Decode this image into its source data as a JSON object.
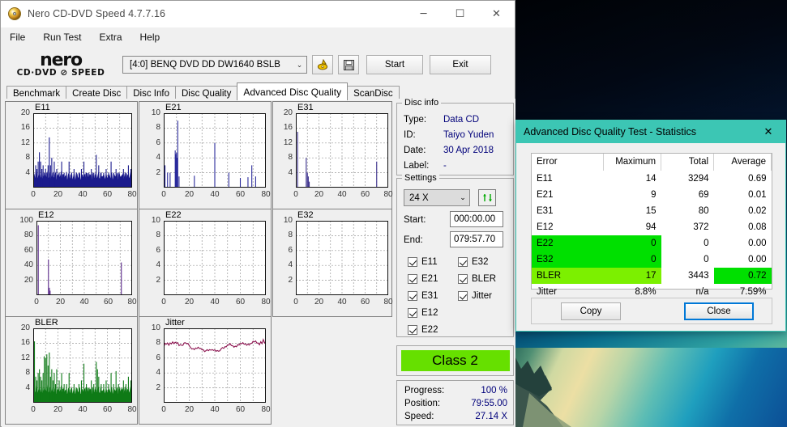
{
  "window": {
    "title": "Nero CD-DVD Speed 4.7.7.16",
    "icon": "nero-disc-icon",
    "minimize": "─",
    "maximize": "☐",
    "close": "✕"
  },
  "menu": {
    "items": [
      "File",
      "Run Test",
      "Extra",
      "Help"
    ]
  },
  "toolbar": {
    "logo_line1": "nero",
    "logo_line2": "CD·DVD ⊘ SPEED",
    "drive": "[4:0]   BENQ DVD DD DW1640 BSLB",
    "drive_arrow": "⌄",
    "eject_icon": "eject-disc-icon",
    "save_icon": "floppy-save-icon",
    "start_label": "Start",
    "exit_label": "Exit"
  },
  "tabs": {
    "items": [
      "Benchmark",
      "Create Disc",
      "Disc Info",
      "Disc Quality",
      "Advanced Disc Quality",
      "ScanDisc"
    ],
    "active": "Advanced Disc Quality"
  },
  "disc_info": {
    "legend": "Disc info",
    "rows": [
      {
        "key": "Type:",
        "value": "Data CD"
      },
      {
        "key": "ID:",
        "value": "Taiyo Yuden"
      },
      {
        "key": "Date:",
        "value": "30 Apr 2018"
      },
      {
        "key": "Label:",
        "value": "-"
      }
    ]
  },
  "settings": {
    "legend": "Settings",
    "speed": "24 X",
    "speed_arrow": "⌄",
    "refresh_icon": "refresh-speed-icon",
    "start_label": "Start:",
    "start_value": "000:00.00",
    "end_label": "End:",
    "end_value": "079:57.70",
    "checkboxes_left": [
      "E11",
      "E21",
      "E31",
      "E12",
      "E22"
    ],
    "checkboxes_right": [
      "E32",
      "BLER",
      "Jitter"
    ]
  },
  "class": {
    "label": "Class 2",
    "color": "#66e000"
  },
  "progress": {
    "rows": [
      {
        "key": "Progress:",
        "value": "100 %"
      },
      {
        "key": "Position:",
        "value": "79:55.00"
      },
      {
        "key": "Speed:",
        "value": "27.14 X"
      }
    ]
  },
  "stats_dialog": {
    "title": "Advanced Disc Quality Test - Statistics",
    "close_icon": "✕",
    "columns": [
      "Error",
      "Maximum",
      "Total",
      "Average"
    ],
    "rows": [
      {
        "error": "E11",
        "maximum": "14",
        "total": "3294",
        "average": "0.69",
        "hl": "none"
      },
      {
        "error": "E21",
        "maximum": "9",
        "total": "69",
        "average": "0.01",
        "hl": "none"
      },
      {
        "error": "E31",
        "maximum": "15",
        "total": "80",
        "average": "0.02",
        "hl": "none"
      },
      {
        "error": "E12",
        "maximum": "94",
        "total": "372",
        "average": "0.08",
        "hl": "none"
      },
      {
        "error": "E22",
        "maximum": "0",
        "total": "0",
        "average": "0.00",
        "hl": "green"
      },
      {
        "error": "E32",
        "maximum": "0",
        "total": "0",
        "average": "0.00",
        "hl": "green"
      },
      {
        "error": "BLER",
        "maximum": "17",
        "total": "3443",
        "average": "0.72",
        "hl": "bler"
      },
      {
        "error": "Jitter",
        "maximum": "8.8%",
        "total": "n/a",
        "average": "7.59%",
        "hl": "none"
      }
    ],
    "copy_label": "Copy",
    "close_label": "Close",
    "highlight_green": "#00e000",
    "highlight_bler": "#7cf000"
  },
  "chart_data": [
    {
      "type": "bar",
      "title": "E11",
      "color": "#1a1a8c",
      "xlabel": "",
      "ylabel": "",
      "xlim": [
        0,
        80
      ],
      "ylim": [
        0,
        20
      ],
      "xticks": [
        0,
        20,
        40,
        60,
        80
      ],
      "yticks": [
        4,
        8,
        12,
        16,
        20
      ],
      "grid": true,
      "baseline": 2.2,
      "peaks": [
        [
          1,
          3
        ],
        [
          2,
          6
        ],
        [
          3,
          5
        ],
        [
          4,
          7
        ],
        [
          5,
          9.5
        ],
        [
          6,
          7
        ],
        [
          7,
          5
        ],
        [
          8,
          6
        ],
        [
          9,
          4
        ],
        [
          10,
          5
        ],
        [
          11,
          4
        ],
        [
          12,
          6
        ],
        [
          13,
          13.5
        ],
        [
          14,
          6
        ],
        [
          15,
          8
        ],
        [
          16,
          4
        ],
        [
          17,
          7
        ],
        [
          18,
          4
        ],
        [
          19,
          5
        ],
        [
          21,
          4
        ],
        [
          23,
          7
        ],
        [
          25,
          4
        ],
        [
          27,
          4
        ],
        [
          29,
          7
        ],
        [
          31,
          4
        ],
        [
          33,
          5
        ],
        [
          35,
          4
        ],
        [
          37,
          4
        ],
        [
          39,
          5
        ],
        [
          41,
          7
        ],
        [
          43,
          4
        ],
        [
          45,
          4
        ],
        [
          47,
          5
        ],
        [
          49,
          4
        ],
        [
          51,
          8.8
        ],
        [
          53,
          6
        ],
        [
          55,
          4
        ],
        [
          57,
          4
        ],
        [
          59,
          5
        ],
        [
          61,
          4
        ],
        [
          63,
          7
        ],
        [
          65,
          4
        ],
        [
          67,
          5
        ],
        [
          69,
          4
        ],
        [
          71,
          3
        ],
        [
          73,
          5
        ],
        [
          75,
          4
        ],
        [
          77,
          6
        ],
        [
          79,
          5
        ]
      ]
    },
    {
      "type": "bar",
      "title": "E21",
      "color": "#2b2b9c",
      "xlabel": "",
      "ylabel": "",
      "xlim": [
        0,
        80
      ],
      "ylim": [
        0,
        10
      ],
      "xticks": [
        0,
        20,
        40,
        60,
        80
      ],
      "yticks": [
        2,
        4,
        6,
        8,
        10
      ],
      "grid": true,
      "baseline": 0,
      "peaks": [
        [
          1,
          3
        ],
        [
          3,
          2
        ],
        [
          5,
          2
        ],
        [
          9,
          5
        ],
        [
          9.5,
          4.5
        ],
        [
          10,
          4.7
        ],
        [
          10.5,
          4
        ],
        [
          11,
          9
        ],
        [
          12,
          1.5
        ],
        [
          24,
          1.6
        ],
        [
          40,
          6
        ],
        [
          51,
          2
        ],
        [
          60,
          1.3
        ],
        [
          66,
          1.4
        ],
        [
          69,
          3
        ],
        [
          72,
          1.5
        ]
      ]
    },
    {
      "type": "bar",
      "title": "E31",
      "color": "#3a2f8c",
      "xlabel": "",
      "ylabel": "",
      "xlim": [
        0,
        80
      ],
      "ylim": [
        0,
        20
      ],
      "xticks": [
        0,
        20,
        40,
        60,
        80
      ],
      "yticks": [
        4,
        8,
        12,
        16,
        20
      ],
      "grid": true,
      "baseline": 0,
      "peaks": [
        [
          1.5,
          15
        ],
        [
          9,
          8
        ],
        [
          10,
          4
        ],
        [
          10.8,
          3
        ],
        [
          11.6,
          1.6
        ],
        [
          70,
          7
        ]
      ]
    },
    {
      "type": "bar",
      "title": "E12",
      "color": "#5b2a8c",
      "xlabel": "",
      "ylabel": "",
      "xlim": [
        0,
        80
      ],
      "ylim": [
        0,
        100
      ],
      "xticks": [
        0,
        20,
        40,
        60,
        80
      ],
      "yticks": [
        20,
        40,
        60,
        80,
        100
      ],
      "grid": true,
      "baseline": 0,
      "peaks": [
        [
          1.5,
          94
        ],
        [
          10,
          48
        ],
        [
          10.8,
          10
        ],
        [
          11.4,
          6
        ],
        [
          71,
          44
        ]
      ]
    },
    {
      "type": "bar",
      "title": "E22",
      "color": "#5b2a8c",
      "xlabel": "",
      "ylabel": "",
      "xlim": [
        0,
        80
      ],
      "ylim": [
        0,
        10
      ],
      "xticks": [
        0,
        20,
        40,
        60,
        80
      ],
      "yticks": [
        2,
        4,
        6,
        8,
        10
      ],
      "grid": true,
      "baseline": 0,
      "peaks": []
    },
    {
      "type": "bar",
      "title": "E32",
      "color": "#5b2a8c",
      "xlabel": "",
      "ylabel": "",
      "xlim": [
        0,
        80
      ],
      "ylim": [
        0,
        10
      ],
      "xticks": [
        0,
        20,
        40,
        60,
        80
      ],
      "yticks": [
        2,
        4,
        6,
        8,
        10
      ],
      "grid": true,
      "baseline": 0,
      "peaks": []
    },
    {
      "type": "bar",
      "title": "BLER",
      "color": "#0e7a16",
      "xlabel": "",
      "ylabel": "",
      "xlim": [
        0,
        80
      ],
      "ylim": [
        0,
        20
      ],
      "xticks": [
        0,
        20,
        40,
        60,
        80
      ],
      "yticks": [
        4,
        8,
        12,
        16,
        20
      ],
      "grid": true,
      "baseline": 2.4,
      "peaks": [
        [
          1,
          16.5
        ],
        [
          2,
          7
        ],
        [
          3,
          6
        ],
        [
          4,
          8
        ],
        [
          5,
          9
        ],
        [
          6,
          7
        ],
        [
          7,
          6
        ],
        [
          8,
          8
        ],
        [
          9,
          12.5
        ],
        [
          10,
          12
        ],
        [
          11,
          13
        ],
        [
          12,
          10
        ],
        [
          13,
          13.5
        ],
        [
          14,
          7
        ],
        [
          15,
          9
        ],
        [
          16,
          6
        ],
        [
          17,
          8
        ],
        [
          18,
          5
        ],
        [
          19,
          9
        ],
        [
          21,
          6
        ],
        [
          23,
          8
        ],
        [
          25,
          5
        ],
        [
          27,
          5
        ],
        [
          29,
          8
        ],
        [
          31,
          4
        ],
        [
          33,
          5
        ],
        [
          35,
          4
        ],
        [
          37,
          5
        ],
        [
          39,
          6
        ],
        [
          41,
          10.5
        ],
        [
          43,
          5
        ],
        [
          45,
          4
        ],
        [
          47,
          6
        ],
        [
          49,
          5
        ],
        [
          51,
          11
        ],
        [
          52,
          9
        ],
        [
          53,
          7
        ],
        [
          55,
          5
        ],
        [
          57,
          5
        ],
        [
          59,
          6
        ],
        [
          61,
          5
        ],
        [
          63,
          8
        ],
        [
          65,
          5
        ],
        [
          67,
          8.5
        ],
        [
          69,
          5
        ],
        [
          71,
          4
        ],
        [
          73,
          6
        ],
        [
          75,
          5
        ],
        [
          77,
          7
        ],
        [
          79,
          6
        ]
      ]
    },
    {
      "type": "line",
      "title": "Jitter",
      "color": "#8c1450",
      "xlabel": "",
      "ylabel": "",
      "xlim": [
        0,
        80
      ],
      "ylim": [
        0,
        10
      ],
      "xticks": [
        0,
        20,
        40,
        60,
        80
      ],
      "yticks": [
        2,
        4,
        6,
        8,
        10
      ],
      "grid": true,
      "series_avg": 7.59,
      "points": [
        [
          0,
          0
        ],
        [
          0.3,
          7.6
        ],
        [
          1,
          8.0
        ],
        [
          2,
          7.9
        ],
        [
          3,
          8.1
        ],
        [
          4,
          7.8
        ],
        [
          5,
          8.1
        ],
        [
          6,
          7.9
        ],
        [
          7,
          8.1
        ],
        [
          8,
          7.8
        ],
        [
          9,
          8.0
        ],
        [
          10,
          7.9
        ],
        [
          11,
          8.1
        ],
        [
          12,
          7.8
        ],
        [
          13,
          8.0
        ],
        [
          14,
          7.9
        ],
        [
          15,
          7.8
        ],
        [
          16,
          8.0
        ],
        [
          17,
          7.9
        ],
        [
          18,
          7.7
        ],
        [
          19,
          7.8
        ],
        [
          20,
          7.6
        ],
        [
          21,
          7.5
        ],
        [
          22,
          7.4
        ],
        [
          23,
          7.5
        ],
        [
          24,
          7.3
        ],
        [
          25,
          7.4
        ],
        [
          26,
          7.2
        ],
        [
          27,
          7.3
        ],
        [
          28,
          7.1
        ],
        [
          29,
          7.2
        ],
        [
          30,
          7.1
        ],
        [
          31,
          7.2
        ],
        [
          32,
          7.0
        ],
        [
          33,
          7.1
        ],
        [
          34,
          7.2
        ],
        [
          35,
          7.0
        ],
        [
          36,
          7.1
        ],
        [
          37,
          7.0
        ],
        [
          38,
          7.1
        ],
        [
          39,
          7.0
        ],
        [
          40,
          7.1
        ],
        [
          41,
          6.9
        ],
        [
          42,
          7.0
        ],
        [
          43,
          6.9
        ],
        [
          44,
          7.0
        ],
        [
          45,
          7.3
        ],
        [
          46,
          7.5
        ],
        [
          47,
          7.4
        ],
        [
          48,
          7.6
        ],
        [
          49,
          7.5
        ],
        [
          50,
          7.7
        ],
        [
          51,
          7.6
        ],
        [
          52,
          7.8
        ],
        [
          53,
          7.6
        ],
        [
          54,
          7.7
        ],
        [
          55,
          7.6
        ],
        [
          56,
          7.8
        ],
        [
          57,
          7.7
        ],
        [
          58,
          7.9
        ],
        [
          59,
          7.7
        ],
        [
          60,
          7.8
        ],
        [
          61,
          7.7
        ],
        [
          62,
          7.9
        ],
        [
          63,
          7.8
        ],
        [
          64,
          8.0
        ],
        [
          65,
          7.9
        ],
        [
          66,
          8.1
        ],
        [
          67,
          7.9
        ],
        [
          68,
          8.0
        ],
        [
          69,
          7.9
        ],
        [
          70,
          8.1
        ],
        [
          71,
          8.0
        ],
        [
          72,
          8.2
        ],
        [
          73,
          8.0
        ],
        [
          74,
          8.1
        ],
        [
          75,
          7.9
        ],
        [
          76,
          8.3
        ],
        [
          77,
          8.0
        ],
        [
          78,
          8.5
        ],
        [
          79,
          8.0
        ],
        [
          80,
          8.2
        ]
      ]
    }
  ]
}
